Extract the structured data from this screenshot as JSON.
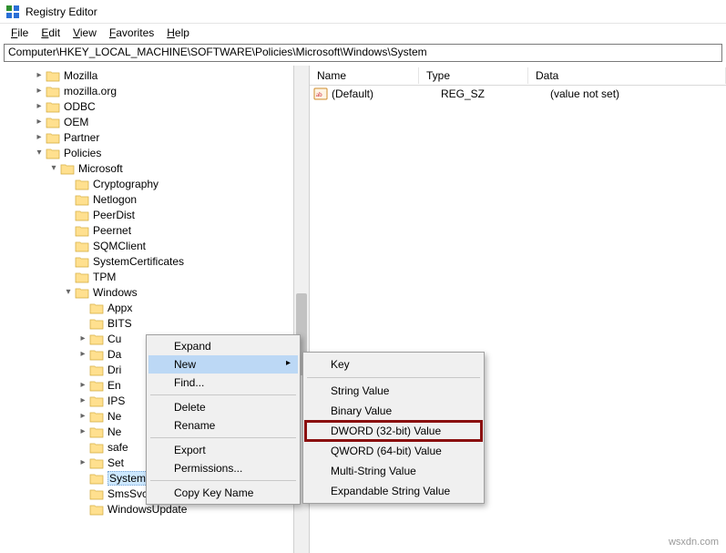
{
  "window": {
    "title": "Registry Editor"
  },
  "menu": {
    "file": {
      "letter": "F",
      "rest": "ile"
    },
    "edit": {
      "letter": "E",
      "rest": "dit"
    },
    "view": {
      "letter": "V",
      "rest": "iew"
    },
    "favorites": {
      "letter": "F",
      "rest": "avorites"
    },
    "help": {
      "letter": "H",
      "rest": "elp"
    }
  },
  "address": "Computer\\HKEY_LOCAL_MACHINE\\SOFTWARE\\Policies\\Microsoft\\Windows\\System",
  "tree_siblings": [
    "Mozilla",
    "mozilla.org",
    "ODBC",
    "OEM",
    "Partner"
  ],
  "tree_policies_label": "Policies",
  "tree_microsoft_label": "Microsoft",
  "microsoft_children_plain": [
    "Cryptography",
    "Netlogon",
    "PeerDist",
    "Peernet",
    "SQMClient",
    "SystemCertificates",
    "TPM"
  ],
  "tree_windows_label": "Windows",
  "windows_children": [
    {
      "label": "Appx",
      "chev": false
    },
    {
      "label": "BITS",
      "chev": false,
      "truncate": true
    },
    {
      "label": "Cu",
      "chev": true,
      "truncate": true
    },
    {
      "label": "Da",
      "chev": true,
      "truncate": true
    },
    {
      "label": "Dri",
      "chev": false,
      "truncate": true
    },
    {
      "label": "En",
      "chev": true,
      "truncate": true
    },
    {
      "label": "IPS",
      "chev": true,
      "truncate": true
    },
    {
      "label": "Ne",
      "chev": true,
      "truncate": true
    },
    {
      "label": "Ne",
      "chev": true,
      "truncate": true
    },
    {
      "label": "safe",
      "chev": false,
      "truncate": true
    },
    {
      "label": "Set",
      "chev": true,
      "truncate": true
    },
    {
      "label": "System",
      "chev": false,
      "selected": true
    },
    {
      "label": "SmsSvc",
      "chev": false
    },
    {
      "label": "WindowsUpdate",
      "chev": false
    }
  ],
  "values_header": {
    "name": "Name",
    "type": "Type",
    "data": "Data"
  },
  "values": [
    {
      "name": "(Default)",
      "type": "REG_SZ",
      "data": "(value not set)"
    }
  ],
  "context1": {
    "items": [
      {
        "label": "Expand",
        "kind": "item"
      },
      {
        "label": "New",
        "kind": "item",
        "hover": true,
        "hasSub": true
      },
      {
        "label": "Find...",
        "kind": "item"
      },
      {
        "kind": "sep"
      },
      {
        "label": "Delete",
        "kind": "item"
      },
      {
        "label": "Rename",
        "kind": "item"
      },
      {
        "kind": "sep"
      },
      {
        "label": "Export",
        "kind": "item"
      },
      {
        "label": "Permissions...",
        "kind": "item"
      },
      {
        "kind": "sep"
      },
      {
        "label": "Copy Key Name",
        "kind": "item"
      }
    ]
  },
  "context2": {
    "items": [
      {
        "label": "Key",
        "kind": "item"
      },
      {
        "kind": "sep"
      },
      {
        "label": "String Value",
        "kind": "item"
      },
      {
        "label": "Binary Value",
        "kind": "item"
      },
      {
        "label": "DWORD (32-bit) Value",
        "kind": "item",
        "highlight": true
      },
      {
        "label": "QWORD (64-bit) Value",
        "kind": "item"
      },
      {
        "label": "Multi-String Value",
        "kind": "item"
      },
      {
        "label": "Expandable String Value",
        "kind": "item"
      }
    ]
  },
  "watermark": "wsxdn.com"
}
